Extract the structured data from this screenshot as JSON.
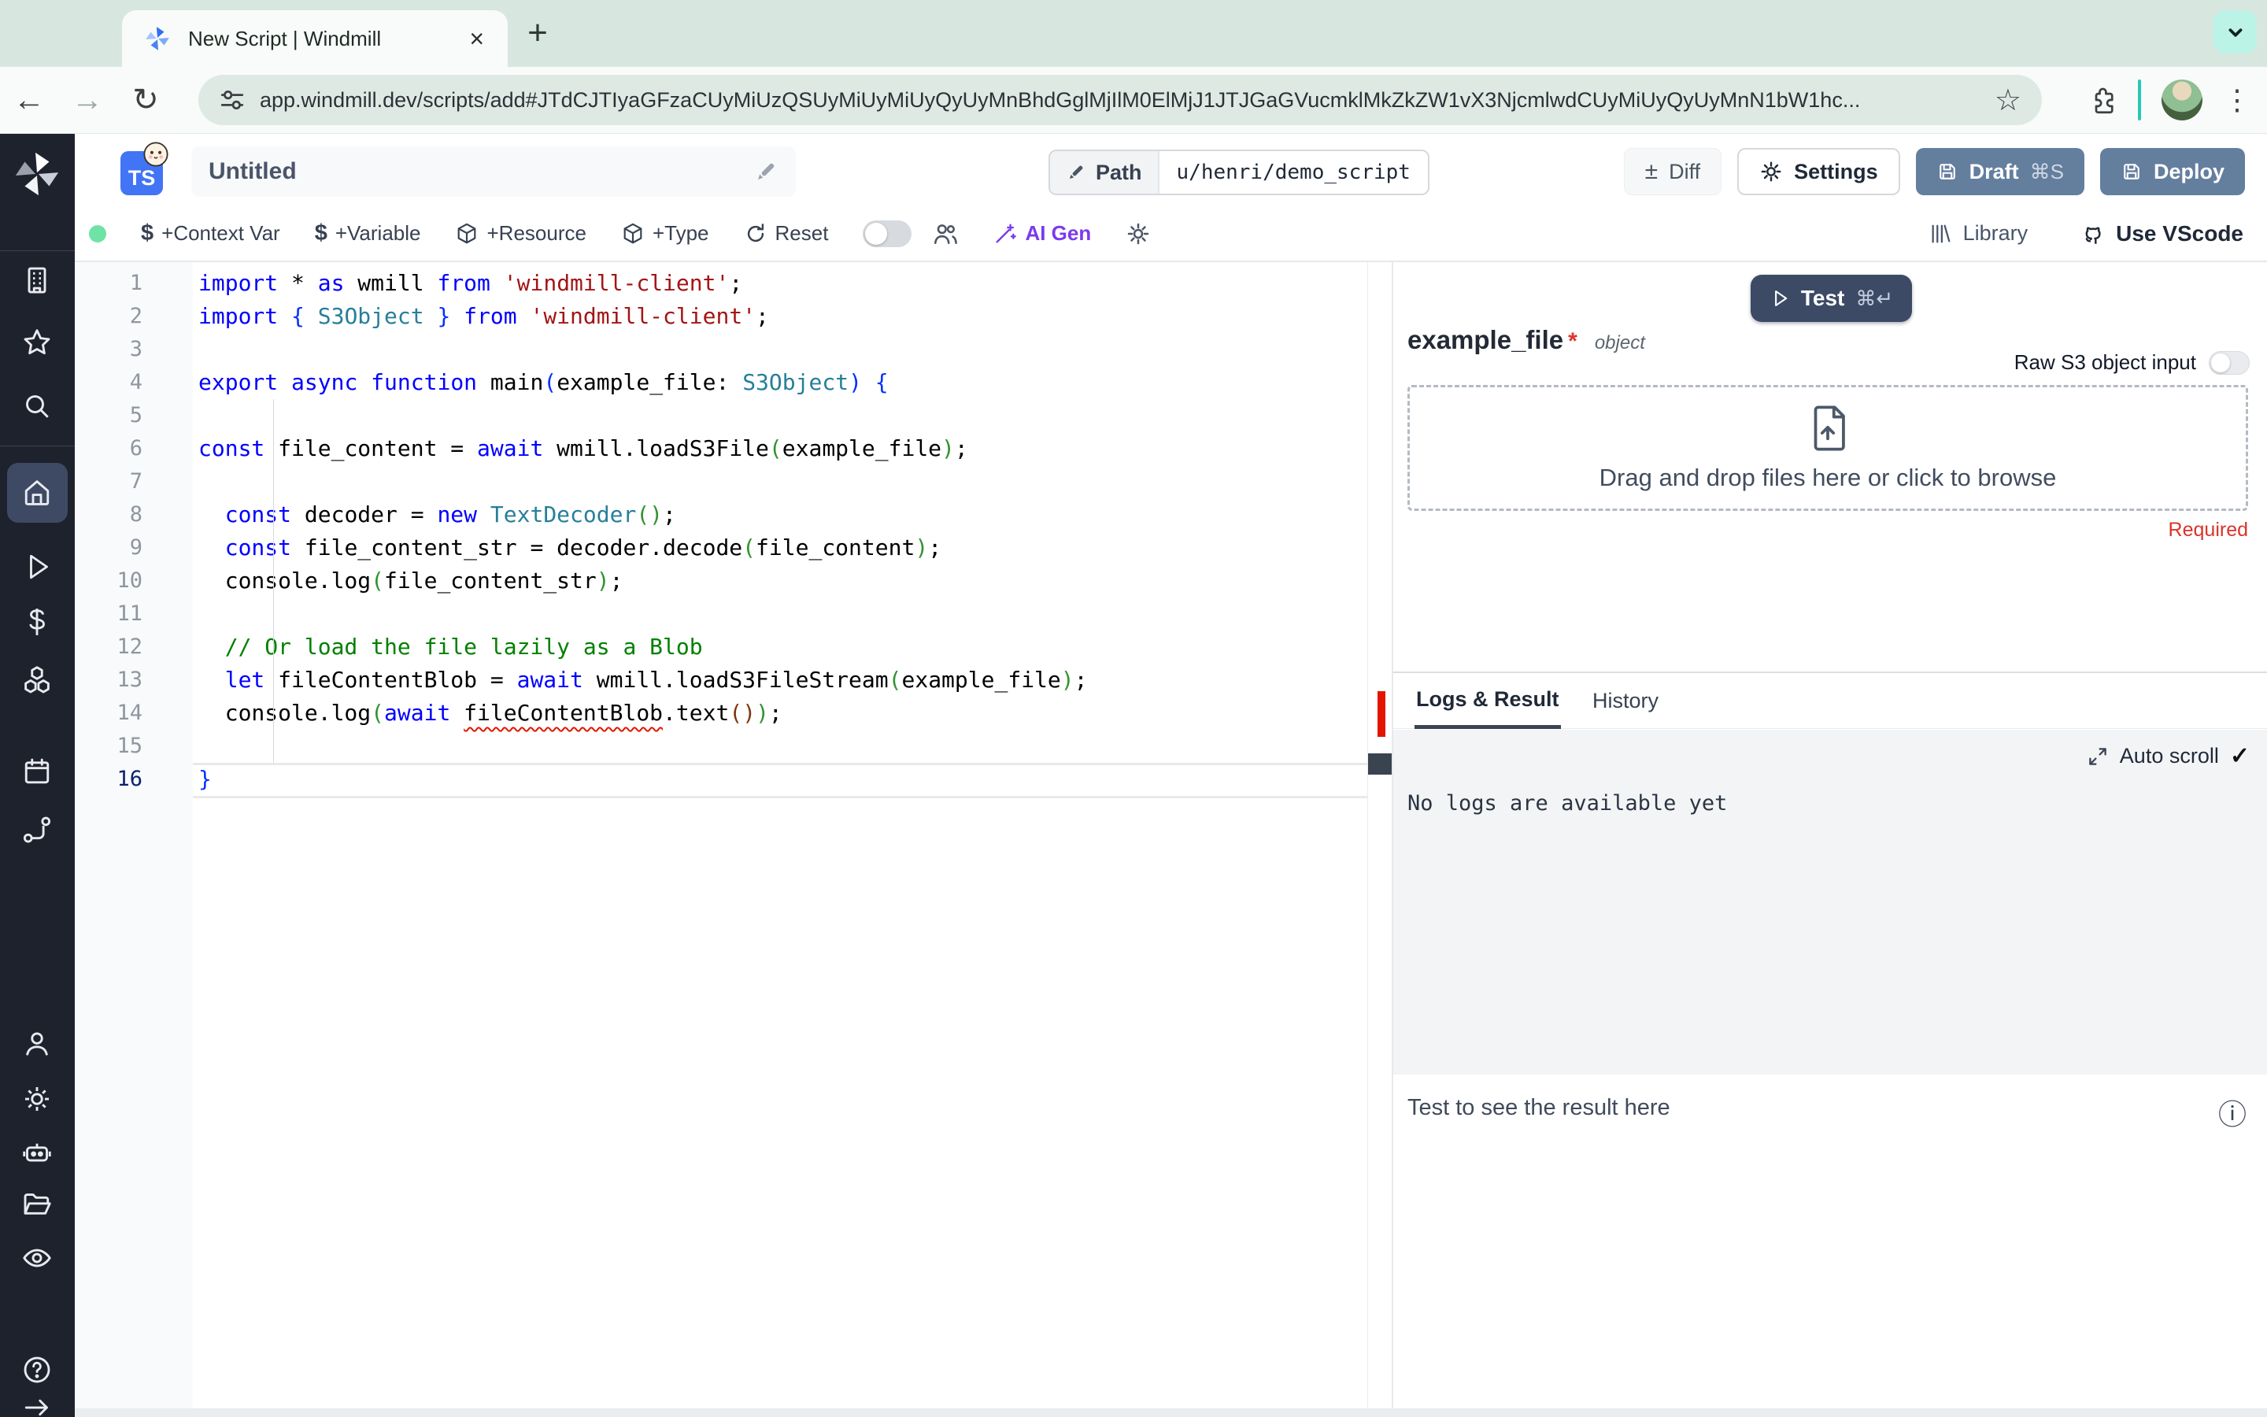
{
  "browser": {
    "tab_title": "New Script | Windmill",
    "close_glyph": "×",
    "new_tab_glyph": "+",
    "back_glyph": "←",
    "forward_glyph": "→",
    "reload_glyph": "↻",
    "url": "app.windmill.dev/scripts/add#JTdCJTIyaGFzaCUyMiUzQSUyMiUyMiUyQyUyMnBhdGglMjIlM0ElMjJ1JTJGaGVucmklMkZkZW1vX3NjcmlwdCUyMiUyQyUyMnN1bW1hc...",
    "star_glyph": "☆",
    "kebab_glyph": "⋮"
  },
  "header": {
    "lang_badge": "TS",
    "script_title": "Untitled",
    "path_label": "Path",
    "path_value": "u/henri/demo_script",
    "diff_glyph": "±",
    "diff_label": "Diff",
    "settings_label": "Settings",
    "draft_label": "Draft",
    "draft_shortcut": "⌘S",
    "deploy_label": "Deploy"
  },
  "toolbar": {
    "items": [
      {
        "icon": "dollar-icon",
        "label": "+Context Var"
      },
      {
        "icon": "dollar-icon",
        "label": "+Variable"
      },
      {
        "icon": "cube-icon",
        "label": "+Resource"
      },
      {
        "icon": "cube-icon",
        "label": "+Type"
      },
      {
        "icon": "reset-icon",
        "label": "Reset"
      }
    ],
    "ai_gen_label": "AI Gen",
    "library_label": "Library",
    "vscode_label": "Use VScode"
  },
  "sidebar": {
    "items": [
      "building",
      "star",
      "search",
      "home",
      "play",
      "dollar",
      "cubes",
      "calendar",
      "route",
      "person",
      "gear",
      "robot",
      "folder",
      "eye",
      "help",
      "arrow-right"
    ]
  },
  "editor": {
    "line_count": 16,
    "active_line": 16,
    "lines": [
      [
        {
          "c": "kw",
          "t": "import"
        },
        {
          "c": "p",
          "t": " * "
        },
        {
          "c": "kw",
          "t": "as"
        },
        {
          "c": "p",
          "t": " wmill "
        },
        {
          "c": "kw",
          "t": "from"
        },
        {
          "c": "p",
          "t": " "
        },
        {
          "c": "st",
          "t": "'windmill-client'"
        },
        {
          "c": "p",
          "t": ";"
        }
      ],
      [
        {
          "c": "kw",
          "t": "import"
        },
        {
          "c": "p",
          "t": " "
        },
        {
          "c": "b1",
          "t": "{"
        },
        {
          "c": "p",
          "t": " "
        },
        {
          "c": "ty",
          "t": "S3Object"
        },
        {
          "c": "p",
          "t": " "
        },
        {
          "c": "b1",
          "t": "}"
        },
        {
          "c": "p",
          "t": " "
        },
        {
          "c": "kw",
          "t": "from"
        },
        {
          "c": "p",
          "t": " "
        },
        {
          "c": "st",
          "t": "'windmill-client'"
        },
        {
          "c": "p",
          "t": ";"
        }
      ],
      [],
      [
        {
          "c": "kw",
          "t": "export"
        },
        {
          "c": "p",
          "t": " "
        },
        {
          "c": "kw",
          "t": "async"
        },
        {
          "c": "p",
          "t": " "
        },
        {
          "c": "kw",
          "t": "function"
        },
        {
          "c": "p",
          "t": " main"
        },
        {
          "c": "b1",
          "t": "("
        },
        {
          "c": "p",
          "t": "example_file: "
        },
        {
          "c": "ty",
          "t": "S3Object"
        },
        {
          "c": "b1",
          "t": ")"
        },
        {
          "c": "p",
          "t": " "
        },
        {
          "c": "b1",
          "t": "{"
        }
      ],
      [],
      [
        {
          "c": "kw",
          "t": "const"
        },
        {
          "c": "p",
          "t": " file_content = "
        },
        {
          "c": "kw",
          "t": "await"
        },
        {
          "c": "p",
          "t": " wmill.loadS3File"
        },
        {
          "c": "b2",
          "t": "("
        },
        {
          "c": "p",
          "t": "example_file"
        },
        {
          "c": "b2",
          "t": ")"
        },
        {
          "c": "p",
          "t": ";"
        }
      ],
      [],
      [
        {
          "c": "p",
          "t": "  "
        },
        {
          "c": "kw",
          "t": "const"
        },
        {
          "c": "p",
          "t": " decoder = "
        },
        {
          "c": "kw",
          "t": "new"
        },
        {
          "c": "p",
          "t": " "
        },
        {
          "c": "ty",
          "t": "TextDecoder"
        },
        {
          "c": "b2",
          "t": "()"
        },
        {
          "c": "p",
          "t": ";"
        }
      ],
      [
        {
          "c": "p",
          "t": "  "
        },
        {
          "c": "kw",
          "t": "const"
        },
        {
          "c": "p",
          "t": " file_content_str = decoder.decode"
        },
        {
          "c": "b2",
          "t": "("
        },
        {
          "c": "p",
          "t": "file_content"
        },
        {
          "c": "b2",
          "t": ")"
        },
        {
          "c": "p",
          "t": ";"
        }
      ],
      [
        {
          "c": "p",
          "t": "  console.log"
        },
        {
          "c": "b2",
          "t": "("
        },
        {
          "c": "p",
          "t": "file_content_str"
        },
        {
          "c": "b2",
          "t": ")"
        },
        {
          "c": "p",
          "t": ";"
        }
      ],
      [],
      [
        {
          "c": "cm",
          "t": "  // Or load the file lazily as a Blob"
        }
      ],
      [
        {
          "c": "p",
          "t": "  "
        },
        {
          "c": "kw",
          "t": "let"
        },
        {
          "c": "p",
          "t": " fileContentBlob = "
        },
        {
          "c": "kw",
          "t": "await"
        },
        {
          "c": "p",
          "t": " wmill.loadS3FileStream"
        },
        {
          "c": "b2",
          "t": "("
        },
        {
          "c": "p",
          "t": "example_file"
        },
        {
          "c": "b2",
          "t": ")"
        },
        {
          "c": "p",
          "t": ";"
        }
      ],
      [
        {
          "c": "p",
          "t": "  console.log"
        },
        {
          "c": "b2",
          "t": "("
        },
        {
          "c": "kw",
          "t": "await"
        },
        {
          "c": "p",
          "t": " "
        },
        {
          "c": "p sq",
          "t": "fileContentBlob"
        },
        {
          "c": "p",
          "t": ".text"
        },
        {
          "c": "b3",
          "t": "()"
        },
        {
          "c": "b2",
          "t": ")"
        },
        {
          "c": "p",
          "t": ";"
        }
      ],
      [],
      [
        {
          "c": "b1",
          "t": "}"
        }
      ]
    ]
  },
  "panel": {
    "test_label": "Test",
    "test_shortcut": "⌘↵",
    "arg_name": "example_file",
    "required_star": "*",
    "arg_type": "object",
    "raw_s3_label": "Raw S3 object input",
    "dropzone_label": "Drag and drop files here or click to browse",
    "required_label": "Required",
    "tab_logs": "Logs & Result",
    "tab_history": "History",
    "auto_scroll_label": "Auto scroll",
    "check_glyph": "✓",
    "no_logs_text": "No logs are available yet",
    "result_placeholder": "Test to see the result here",
    "info_glyph": "ⓘ"
  },
  "colors": {
    "accent_slate": "#647e9e",
    "test_button": "#3c4a66",
    "ai_violet": "#7c3aed",
    "error_red": "#e51400",
    "required_red": "#d9342b",
    "sidebar_bg": "#1e222d",
    "sidebar_active_bg": "#3e4a63",
    "mint_button": "#bbf3e6",
    "keyword_blue": "#0000ff",
    "string_red": "#a31515",
    "type_teal": "#267f99",
    "comment_green": "#008000"
  }
}
